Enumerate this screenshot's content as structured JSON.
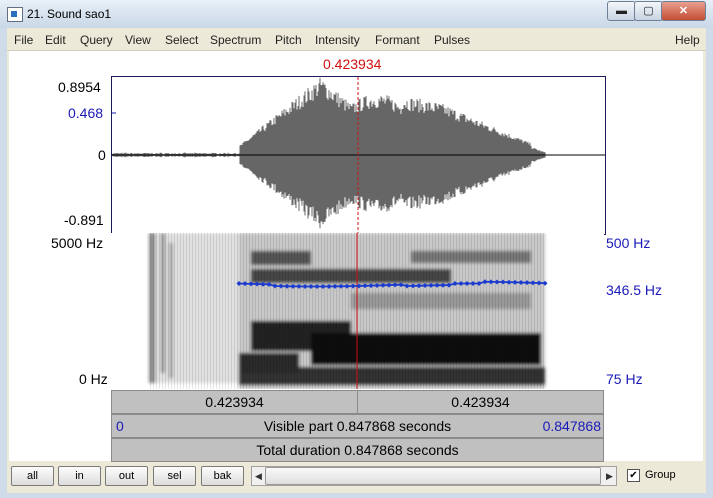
{
  "window": {
    "title": "21. Sound sao1",
    "controls": {
      "minimize": "▬",
      "maximize": "▢",
      "close": "✕"
    }
  },
  "menu": [
    "File",
    "Edit",
    "Query",
    "View",
    "Select",
    "Spectrum",
    "Pitch",
    "Intensity",
    "Formant",
    "Pulses"
  ],
  "help": "Help",
  "cursor": {
    "time_label": "0.423934",
    "time_sec": 0.423934,
    "color": "#d01010"
  },
  "waveform": {
    "ymax_label": "0.8954",
    "cursor_amp_label": "0.468",
    "zero_label": "0",
    "ymin_label": "-0.891"
  },
  "spectrogram": {
    "fmax_label": "5000 Hz",
    "fmin_label": "0 Hz",
    "pitch_max_label": "500 Hz",
    "pitch_cursor_label": "346.5 Hz",
    "pitch_min_label": "75 Hz",
    "pitch_color": "#1a3ad0"
  },
  "time_rows": {
    "left_segment": "0.423934",
    "right_segment": "0.423934",
    "visible_start": "0",
    "visible_text": "Visible part 0.847868 seconds",
    "visible_end": "0.847868",
    "total_text": "Total duration 0.847868 seconds"
  },
  "buttons": {
    "all": "all",
    "in": "in",
    "out": "out",
    "sel": "sel",
    "bak": "bak"
  },
  "scroll": {
    "left_arrow": "◀",
    "right_arrow": "▶"
  },
  "group": {
    "label": "Group",
    "checked": true,
    "check_mark": "✔"
  }
}
